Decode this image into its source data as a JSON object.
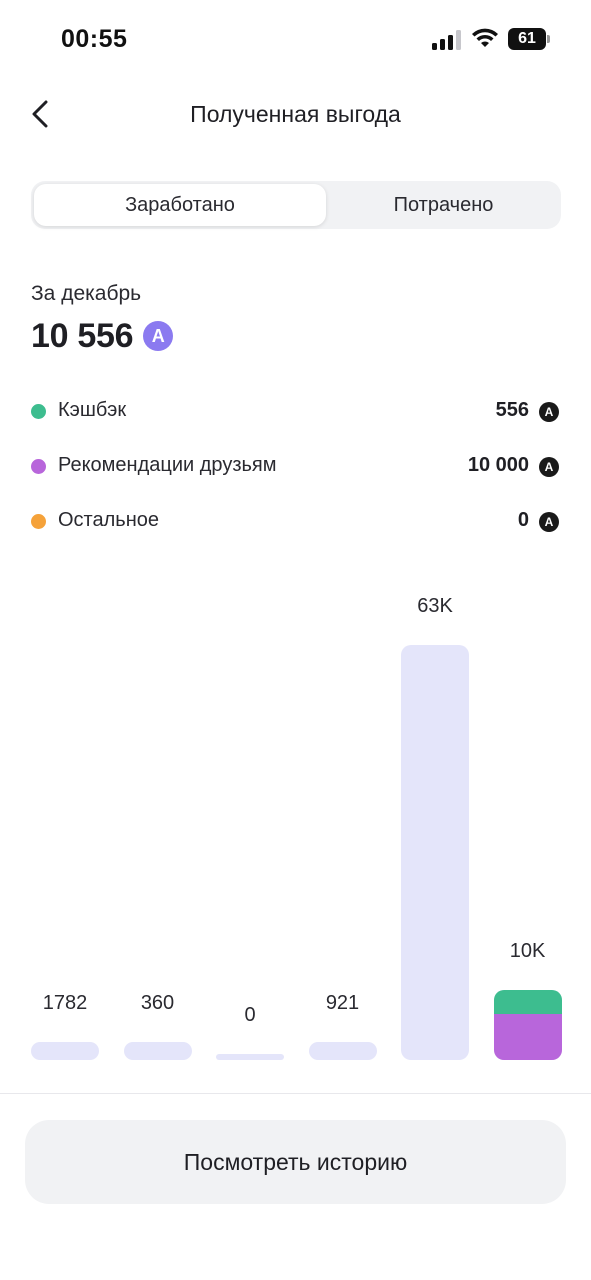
{
  "status_bar": {
    "time": "00:55",
    "battery": "61"
  },
  "header": {
    "title": "Полученная выгода"
  },
  "tabs": [
    {
      "label": "Заработано",
      "active": true
    },
    {
      "label": "Потрачено",
      "active": false
    }
  ],
  "summary": {
    "period": "За декабрь",
    "total": "10 556",
    "coin_symbol": "A"
  },
  "legend": [
    {
      "label": "Кэшбэк",
      "value": "556",
      "color": "#3dbd8f"
    },
    {
      "label": "Рекомендации друзьям",
      "value": "10 000",
      "color": "#b866db"
    },
    {
      "label": "Остальное",
      "value": "0",
      "color": "#f5a23a"
    }
  ],
  "chart_data": {
    "type": "bar",
    "categories": [
      "",
      "",
      "",
      "",
      "",
      ""
    ],
    "labels": [
      "1782",
      "360",
      "0",
      "921",
      "63K",
      "10K"
    ],
    "values": [
      1782,
      360,
      0,
      921,
      63000,
      10556
    ],
    "stacks": [
      null,
      null,
      null,
      null,
      null,
      [
        {
          "name": "Рекомендации друзьям",
          "value": 10000,
          "color": "#b866db"
        },
        {
          "name": "Кэшбэк",
          "value": 556,
          "color": "#3dbd8f"
        }
      ]
    ],
    "bar_color": "#e4e5fa",
    "xlabel": "",
    "ylabel": "",
    "title": ""
  },
  "footer": {
    "history_button": "Посмотреть историю"
  }
}
